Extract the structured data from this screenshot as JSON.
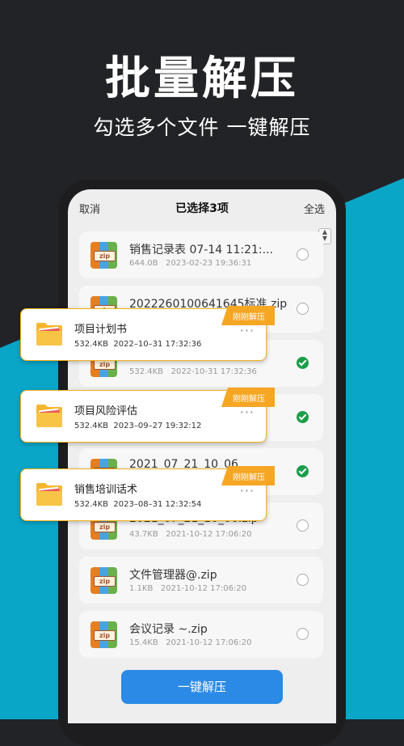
{
  "colors": {
    "accent": "#2b8ae6",
    "check": "#1a9e48",
    "badge": "#f5a623",
    "background": "#222326",
    "blue_band": "#0aa6c8"
  },
  "hero": {
    "title": "批量解压",
    "subtitle": "勾选多个文件  一键解压"
  },
  "topbar": {
    "cancel": "取消",
    "title": "已选择3项",
    "select_all": "全选"
  },
  "files": [
    {
      "name": "销售记录表  07-14 11:21:...",
      "size": "644.0B",
      "date": "2023-02-23 19:36:31",
      "checked": false
    },
    {
      "name": "20222601006416​45标准.zip",
      "size": "",
      "date": "",
      "checked": false
    },
    {
      "name": "",
      "size": "532.4KB",
      "date": "2022-10-31 17:32:36",
      "checked": true
    },
    {
      "name": "",
      "size": "",
      "date": "",
      "checked": true
    },
    {
      "name": "2021_07_21_10_06",
      "size": "",
      "date": "",
      "checked": true
    },
    {
      "name": "2021_07_21_10_06.zip",
      "size": "43.7KB",
      "date": "2021-10-12 17:06:20",
      "checked": false
    },
    {
      "name": "文件管理器@.zip",
      "size": "1.1KB",
      "date": "2021-10-12 17:06:20",
      "checked": false
    },
    {
      "name": "会议记录  ~.zip",
      "size": "15.4KB",
      "date": "2021-10-12 17:06:20",
      "checked": false
    }
  ],
  "zip_tag": "zip",
  "overlay_cards": [
    {
      "name": "项目计划书",
      "size": "532.4KB",
      "date": "2022–10–31  17:32:36",
      "badge": "刚刚解压"
    },
    {
      "name": "项目风险评估",
      "size": "532.4KB",
      "date": "2023–09–27  19:32:12",
      "badge": "刚刚解压"
    },
    {
      "name": "销售培训话术",
      "size": "532.4KB",
      "date": "2023–08–31  12:32:54",
      "badge": "刚刚解压"
    }
  ],
  "bottom_button": "一键解压"
}
